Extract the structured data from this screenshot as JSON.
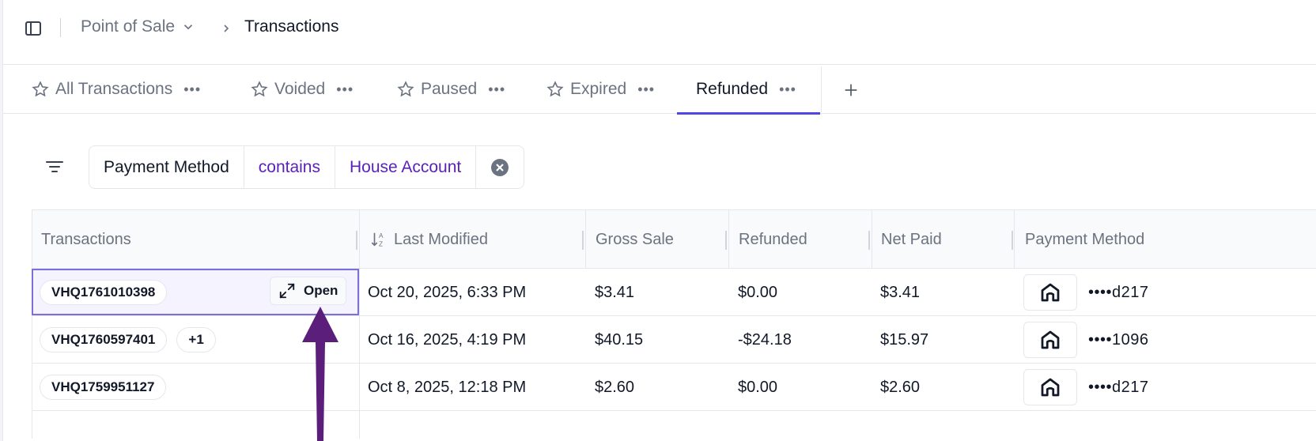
{
  "breadcrumb": {
    "app": "Point of Sale",
    "page": "Transactions"
  },
  "tabs": [
    {
      "label": "All Transactions",
      "active": false
    },
    {
      "label": "Voided",
      "active": false
    },
    {
      "label": "Paused",
      "active": false
    },
    {
      "label": "Expired",
      "active": false
    },
    {
      "label": "Refunded",
      "active": true
    }
  ],
  "tab_menu": "•••",
  "filter": {
    "field": "Payment Method",
    "operator": "contains",
    "value": "House Account"
  },
  "table": {
    "columns": [
      "Transactions",
      "Last Modified",
      "Gross Sale",
      "Refunded",
      "Net Paid",
      "Payment Method"
    ],
    "open_label": "Open",
    "rows": [
      {
        "id": "VHQ1761010398",
        "extra": "",
        "modified": "Oct 20, 2025, 6:33 PM",
        "gross": "$3.41",
        "refunded": "$0.00",
        "net": "$3.41",
        "card": "••••d217"
      },
      {
        "id": "VHQ1760597401",
        "extra": "+1",
        "modified": "Oct 16, 2025, 4:19 PM",
        "gross": "$40.15",
        "refunded": "-$24.18",
        "net": "$15.97",
        "card": "••••1096"
      },
      {
        "id": "VHQ1759951127",
        "extra": "",
        "modified": "Oct 8, 2025, 12:18 PM",
        "gross": "$2.60",
        "refunded": "$0.00",
        "net": "$2.60",
        "card": "••••d217"
      }
    ]
  },
  "colors": {
    "accent": "#4f46e5",
    "filter_value": "#5b21b6",
    "annotation": "#5b1e7a"
  }
}
